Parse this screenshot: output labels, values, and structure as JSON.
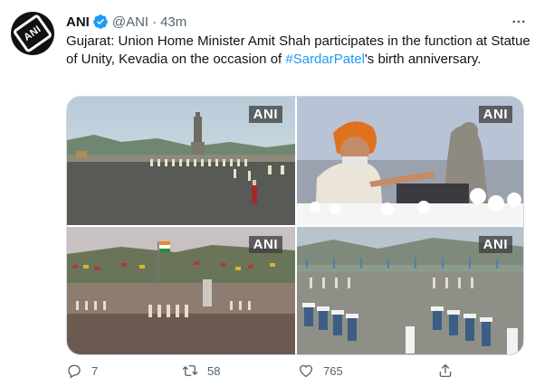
{
  "tweet": {
    "avatar_text": "ANI",
    "name": "ANI",
    "handle": "@ANI",
    "separator": "·",
    "time": "43m",
    "text_before": "Gujarat: Union Home Minister Amit Shah participates in the function at Statue of Unity, Kevadia on the occasion of ",
    "hashtag": "#SardarPatel",
    "text_after": "'s birth anniversary.",
    "media": [
      {
        "watermark": "ANI"
      },
      {
        "watermark": "ANI"
      },
      {
        "watermark": "ANI"
      },
      {
        "watermark": "ANI"
      }
    ],
    "actions": {
      "reply_count": "7",
      "retweet_count": "58",
      "like_count": "765"
    }
  },
  "colors": {
    "accent": "#1d9bf0",
    "text_primary": "#0f1419",
    "text_secondary": "#536471",
    "border": "#cfd9de"
  },
  "icons": {
    "verified": "verified-badge-icon",
    "more": "more-icon",
    "reply": "reply-icon",
    "retweet": "retweet-icon",
    "like": "like-icon",
    "share": "share-icon"
  }
}
